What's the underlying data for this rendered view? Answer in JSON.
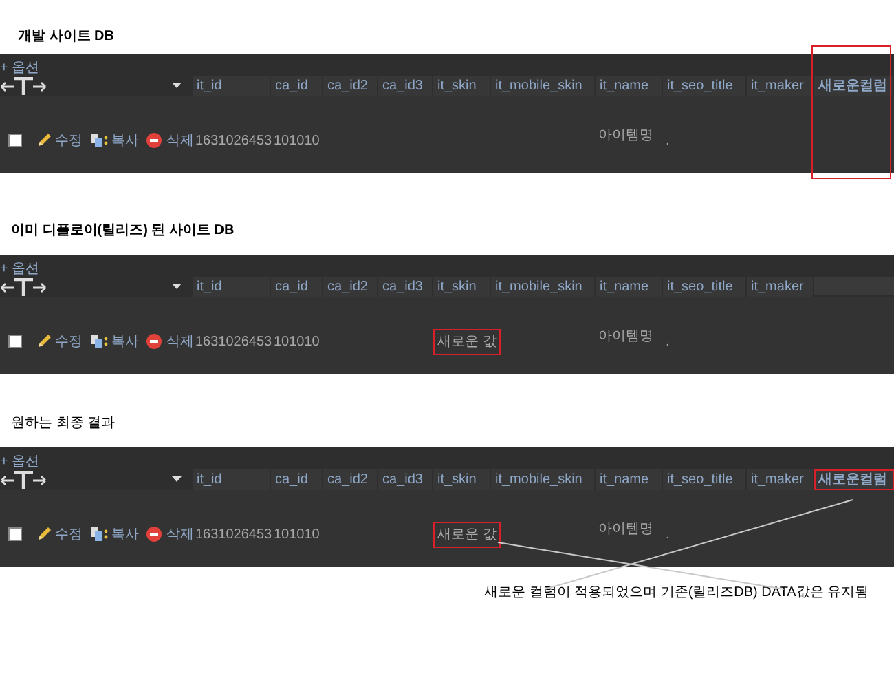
{
  "sections": [
    {
      "title": "개발 사이트 DB",
      "options_label": "+ 옵션",
      "frame_new_column": true,
      "columns": [
        {
          "label": "it_id"
        },
        {
          "label": "ca_id"
        },
        {
          "label": "ca_id2"
        },
        {
          "label": "ca_id3"
        },
        {
          "label": "it_skin"
        },
        {
          "label": "it_mobile_skin"
        },
        {
          "label": "it_name"
        },
        {
          "label": "it_seo_title"
        },
        {
          "label": "it_maker"
        },
        {
          "label": "새로운컬럼",
          "highlighted": false
        }
      ],
      "row": {
        "checked": false,
        "actions": [
          {
            "kind": "edit",
            "label": "수정"
          },
          {
            "kind": "copy",
            "label": "복사"
          },
          {
            "kind": "delete",
            "label": "삭제"
          }
        ],
        "cells": [
          {
            "text": "1631026453"
          },
          {
            "text": "101010"
          },
          {},
          {},
          {},
          {},
          {
            "text": "아이템명"
          },
          {
            "text": "."
          },
          {},
          {}
        ]
      }
    },
    {
      "title": "이미 디플로이(릴리즈) 된 사이트 DB",
      "options_label": "+ 옵션",
      "frame_new_column": false,
      "columns": [
        {
          "label": "it_id"
        },
        {
          "label": "ca_id"
        },
        {
          "label": "ca_id2"
        },
        {
          "label": "ca_id3"
        },
        {
          "label": "it_skin"
        },
        {
          "label": "it_mobile_skin"
        },
        {
          "label": "it_name"
        },
        {
          "label": "it_seo_title"
        },
        {
          "label": "it_maker"
        }
      ],
      "row": {
        "checked": false,
        "actions": [
          {
            "kind": "edit",
            "label": "수정"
          },
          {
            "kind": "copy",
            "label": "복사"
          },
          {
            "kind": "delete",
            "label": "삭제"
          }
        ],
        "cells": [
          {
            "text": "1631026453"
          },
          {
            "text": "101010"
          },
          {},
          {},
          {
            "text": "새로운 값",
            "highlighted": true
          },
          {},
          {
            "text": "아이템명"
          },
          {
            "text": "."
          },
          {}
        ]
      }
    },
    {
      "title": "원하는 최종 결과",
      "options_label": "+ 옵션",
      "frame_new_column": false,
      "columns": [
        {
          "label": "it_id"
        },
        {
          "label": "ca_id"
        },
        {
          "label": "ca_id2"
        },
        {
          "label": "ca_id3"
        },
        {
          "label": "it_skin"
        },
        {
          "label": "it_mobile_skin"
        },
        {
          "label": "it_name"
        },
        {
          "label": "it_seo_title"
        },
        {
          "label": "it_maker"
        },
        {
          "label": "새로운컬럼",
          "highlighted": true
        }
      ],
      "row": {
        "checked": false,
        "actions": [
          {
            "kind": "edit",
            "label": "수정"
          },
          {
            "kind": "copy",
            "label": "복사"
          },
          {
            "kind": "delete",
            "label": "삭제"
          }
        ],
        "cells": [
          {
            "text": "1631026453"
          },
          {
            "text": "101010"
          },
          {},
          {},
          {
            "text": "새로운 값",
            "highlighted": true
          },
          {},
          {
            "text": "아이템명"
          },
          {
            "text": "."
          },
          {},
          {}
        ]
      }
    }
  ],
  "annotation": "새로운 컬럼이 적용되었으며 기존(릴리즈DB) DATA값은 유지됨"
}
